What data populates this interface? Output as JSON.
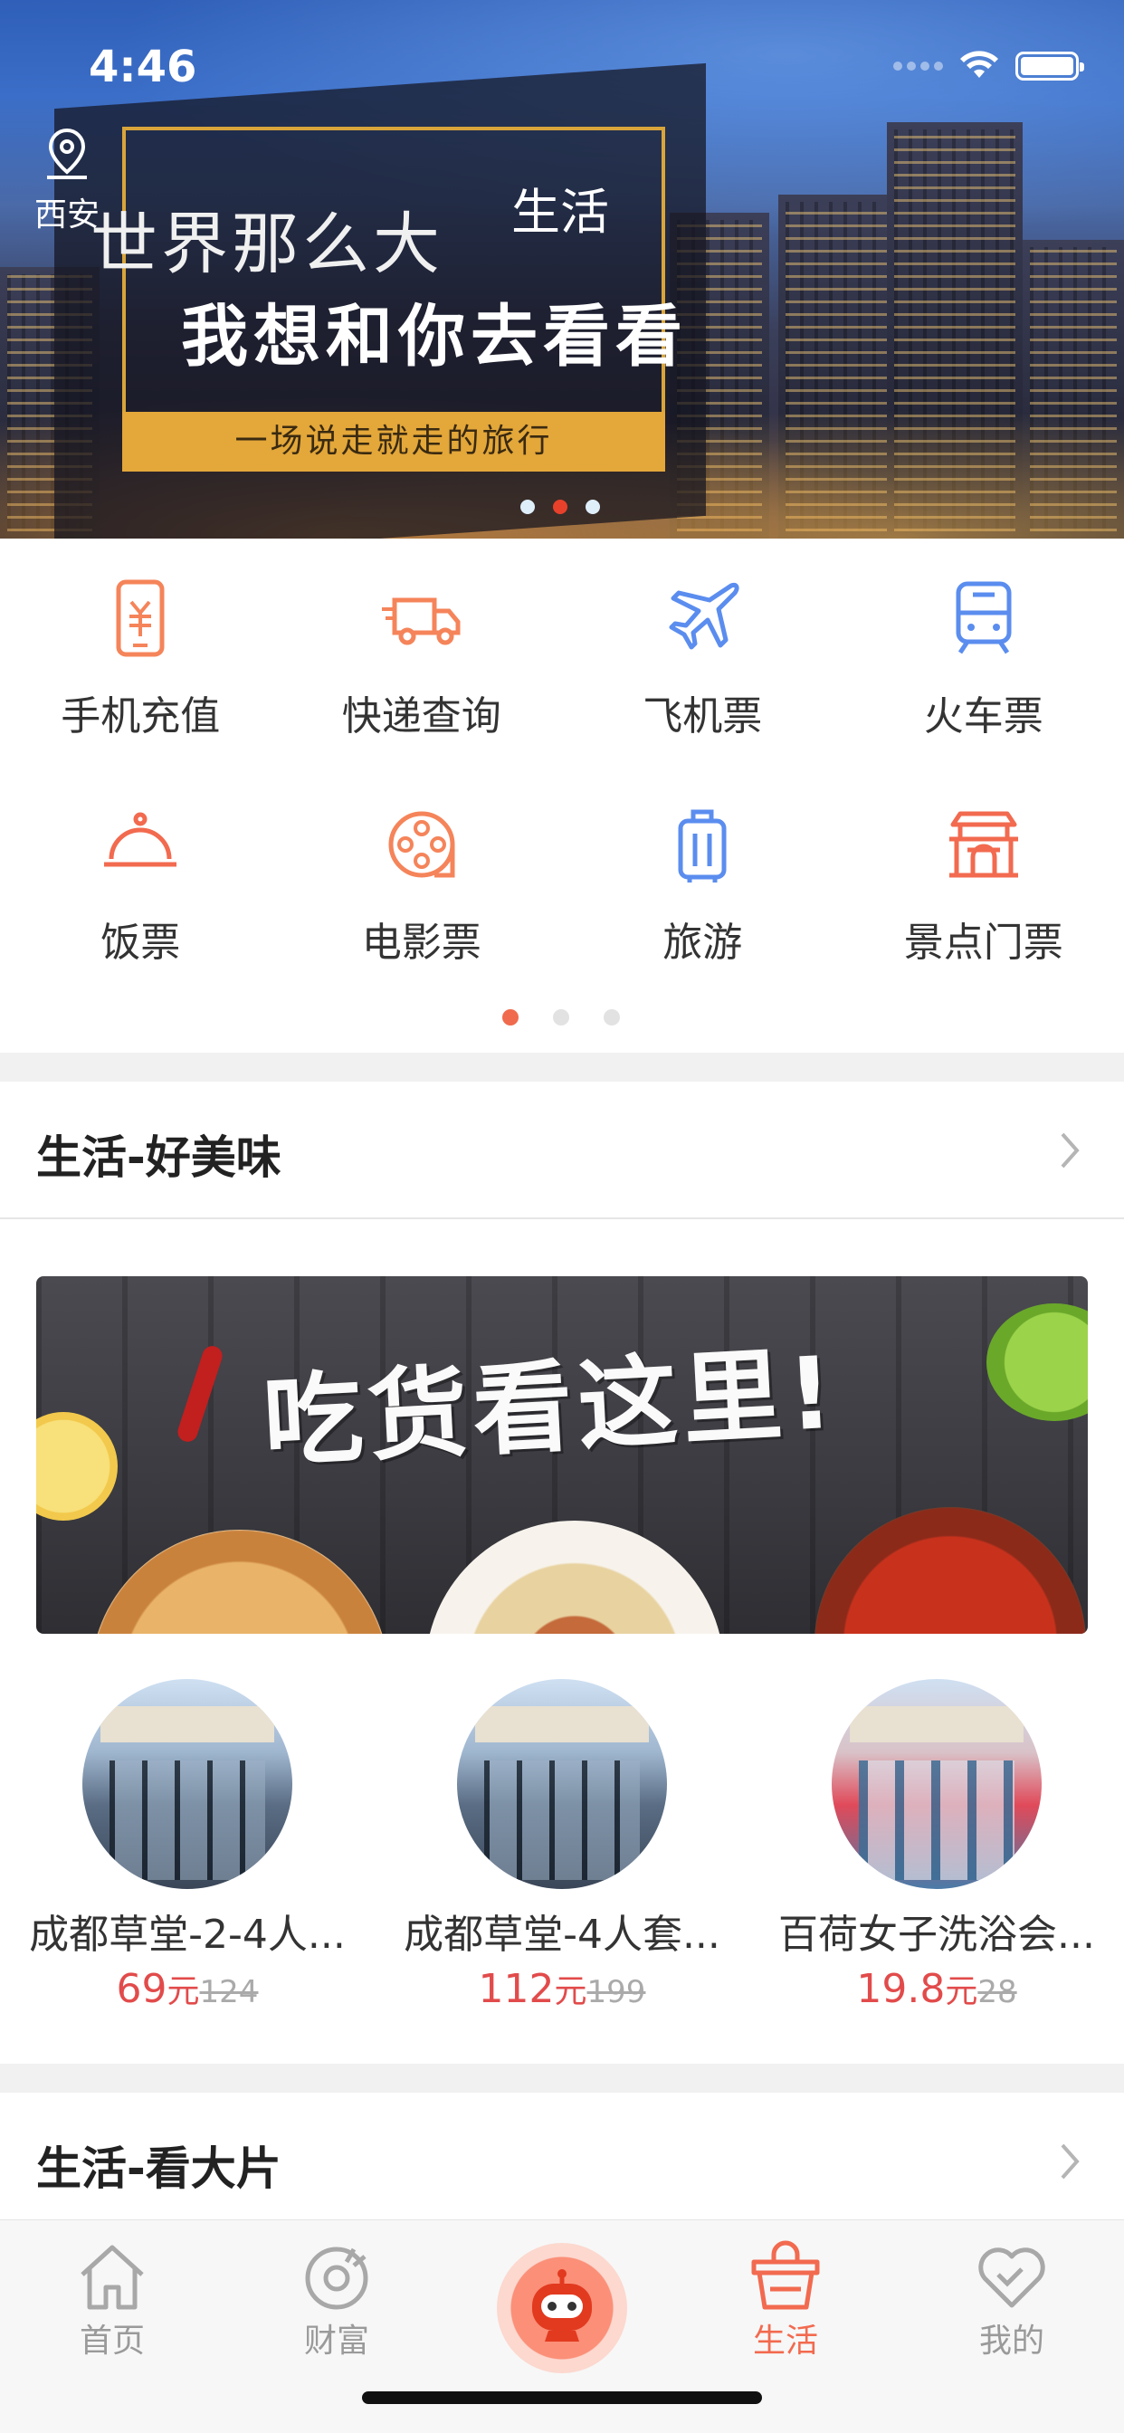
{
  "status_bar": {
    "time": "4:46"
  },
  "header": {
    "city": "西安",
    "title": "生活"
  },
  "banner": {
    "line1": "世界那么大",
    "line2": "我想和你去看看",
    "strip": "一场说走就走的旅行",
    "dots_total": 3,
    "dots_active": 2
  },
  "services": [
    {
      "label": "手机充值",
      "icon": "phone-recharge-icon"
    },
    {
      "label": "快递查询",
      "icon": "delivery-truck-icon"
    },
    {
      "label": "飞机票",
      "icon": "airplane-icon"
    },
    {
      "label": "火车票",
      "icon": "train-icon"
    },
    {
      "label": "饭票",
      "icon": "food-cloche-icon"
    },
    {
      "label": "电影票",
      "icon": "film-reel-icon"
    },
    {
      "label": "旅游",
      "icon": "luggage-icon"
    },
    {
      "label": "景点门票",
      "icon": "pavilion-icon"
    }
  ],
  "services_pages": {
    "total": 3,
    "active": 1
  },
  "section_food": {
    "title": "生活-好美味",
    "banner_text": "吃货看这里!",
    "products": [
      {
        "name": "成都草堂-2-4人...",
        "price": "69",
        "unit": "元",
        "original": "124"
      },
      {
        "name": "成都草堂-4人套...",
        "price": "112",
        "unit": "元",
        "original": "199"
      },
      {
        "name": "百荷女子洗浴会...",
        "price": "19.8",
        "unit": "元",
        "original": "28"
      }
    ]
  },
  "section_movie": {
    "title": "生活-看大片"
  },
  "tabbar": {
    "tabs": [
      {
        "label": "首页",
        "icon": "home-icon"
      },
      {
        "label": "财富",
        "icon": "wealth-icon"
      },
      {
        "label": "生活",
        "icon": "shopping-bag-icon",
        "active": true
      },
      {
        "label": "我的",
        "icon": "heart-icon"
      }
    ],
    "center_icon": "robot-assistant-icon"
  },
  "colors": {
    "accent": "#f26a4f",
    "price": "#e24b4b",
    "blue_icon": "#5b8def",
    "orange_icon": "#f5845a"
  }
}
